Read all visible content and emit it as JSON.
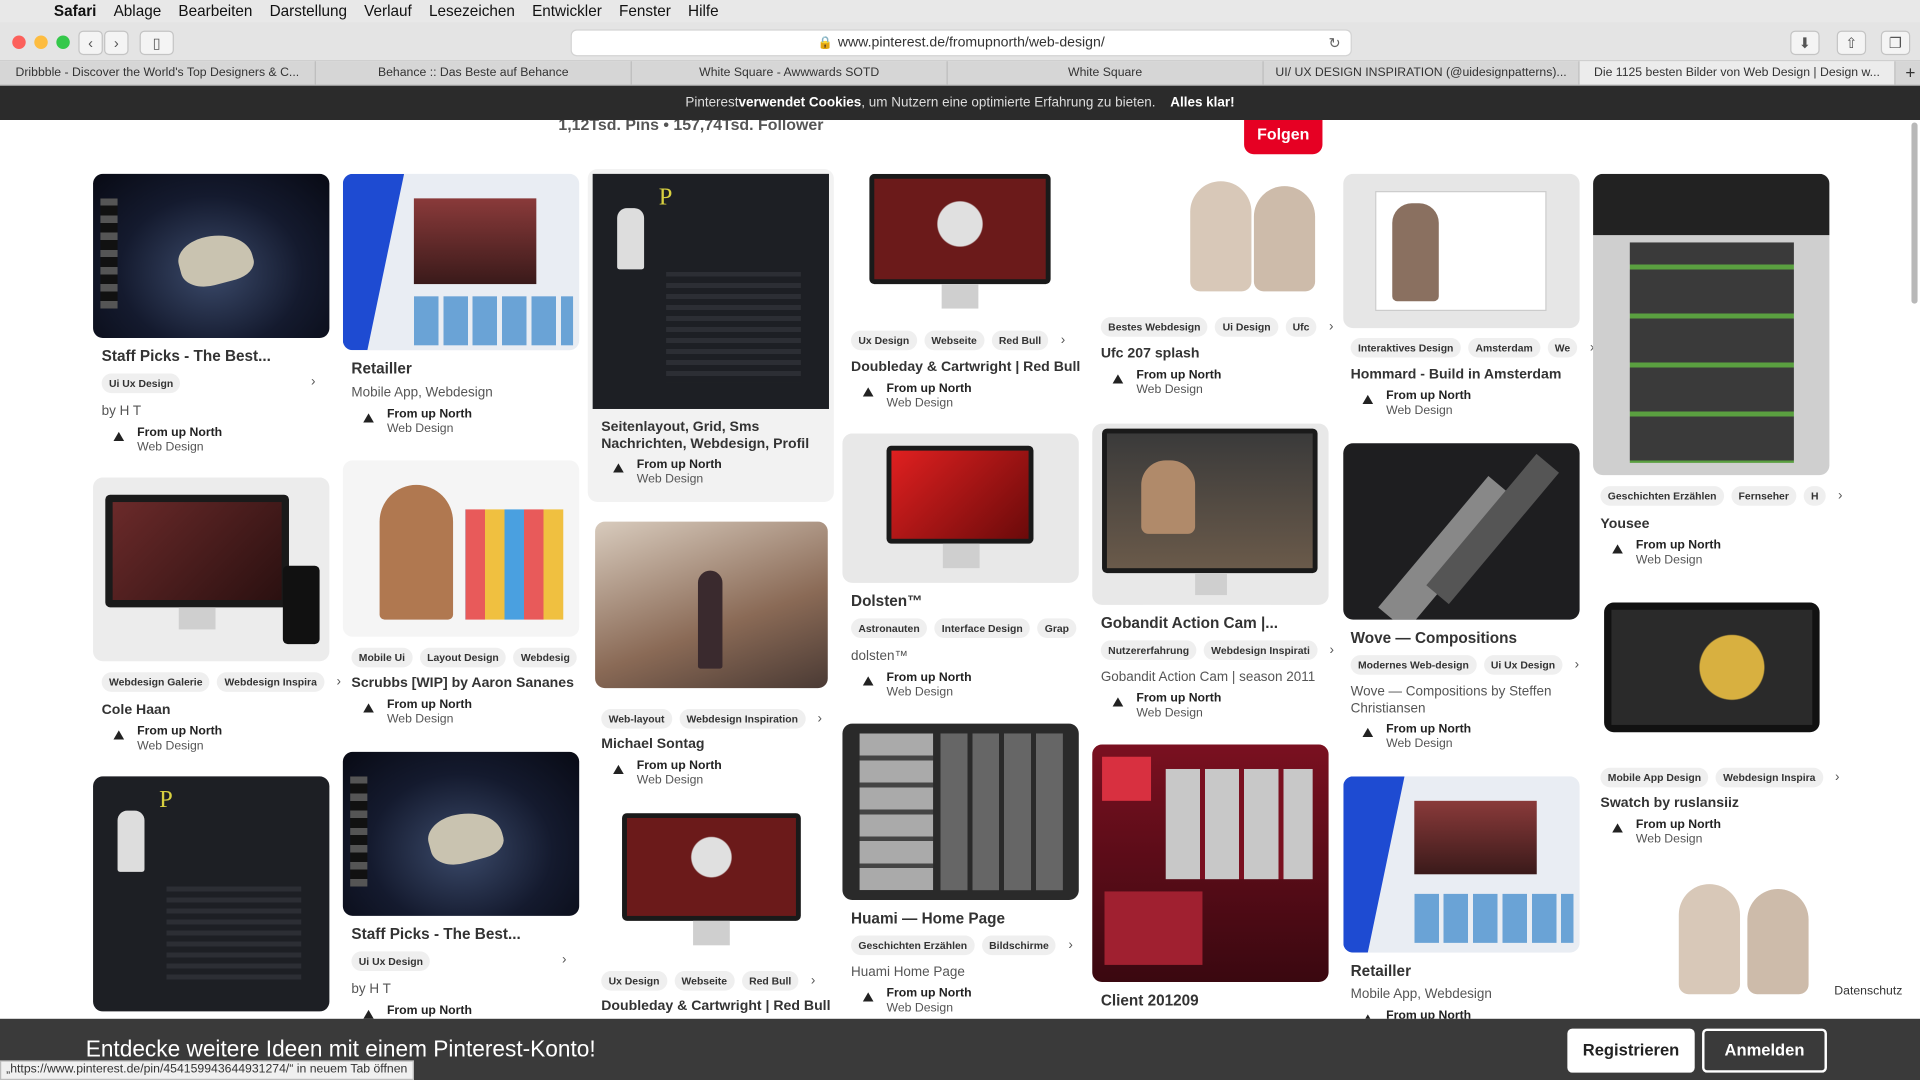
{
  "menubar": {
    "app": "Safari",
    "items": [
      "Ablage",
      "Bearbeiten",
      "Darstellung",
      "Verlauf",
      "Lesezeichen",
      "Entwickler",
      "Fenster",
      "Hilfe"
    ]
  },
  "browser": {
    "url": "www.pinterest.de/fromupnorth/web-design/",
    "tabs": [
      "Dribbble - Discover the World's Top Designers & C...",
      "Behance :: Das Beste auf Behance",
      "White Square - Awwwards SOTD",
      "White Square",
      "UI/ UX DESIGN INSPIRATION (@uidesignpatterns)...",
      "Die 1125 besten Bilder von Web Design | Design w..."
    ],
    "new_tab": "+"
  },
  "cookie": {
    "pre": "Pinterest ",
    "bold": "verwendet Cookies",
    "post": ", um Nutzern eine optimierte Erfahrung zu bieten.",
    "ok": "Alles klar!"
  },
  "board": {
    "stats": "1,12Tsd. Pins • 157,74Tsd. Follower",
    "follow": "Folgen"
  },
  "attribution": {
    "name": "From up North",
    "board": "Web Design"
  },
  "pins": {
    "c1p1": {
      "title": "Staff Picks - The Best...",
      "tags": [
        "Ui Ux Design"
      ],
      "desc": "by H T"
    },
    "c1p2": {
      "title": "Cole Haan",
      "tags": [
        "Webdesign Galerie",
        "Webdesign Inspira"
      ]
    },
    "c2p1": {
      "title": "Retailler",
      "desc": "Mobile App, Webdesign"
    },
    "c2p2": {
      "title": "Scrubbs [WIP] by Aaron Sananes",
      "tags": [
        "Mobile Ui",
        "Layout Design",
        "Webdesig"
      ]
    },
    "c2p3": {
      "title": "Staff Picks - The Best...",
      "tags": [
        "Ui Ux Design"
      ],
      "desc": "by H T"
    },
    "c3p1": {
      "title": "Seitenlayout, Grid, Sms Nachrichten, Webdesign, Profil"
    },
    "c3p2": {
      "title": "Michael Sontag",
      "tags": [
        "Web-layout",
        "Webdesign Inspiration"
      ]
    },
    "c3p3": {
      "title": "Doubleday & Cartwright | Red Bull",
      "tags": [
        "Ux Design",
        "Webseite",
        "Red Bull"
      ]
    },
    "c4p1": {
      "title": "Doubleday & Cartwright | Red Bull",
      "tags": [
        "Ux Design",
        "Webseite",
        "Red Bull"
      ]
    },
    "c4p2": {
      "title": "Dolsten™",
      "tags": [
        "Astronauten",
        "Interface Design",
        "Grap"
      ],
      "desc": "dolsten™"
    },
    "c4p3": {
      "title": "Huami — Home Page",
      "tags": [
        "Geschichten Erzählen",
        "Bildschirme"
      ],
      "desc": "Huami Home Page"
    },
    "c5p1": {
      "title": "Ufc 207 splash",
      "tags": [
        "Bestes Webdesign",
        "Ui Design",
        "Ufc"
      ]
    },
    "c5p2": {
      "title": "Gobandit Action Cam |...",
      "tags": [
        "Nutzererfahrung",
        "Webdesign Inspirati"
      ],
      "desc": "Gobandit Action Cam | season 2011"
    },
    "c5p3": {
      "title": "Client 201209"
    },
    "c6p1": {
      "title": "Hommard - Build in Amsterdam",
      "tags": [
        "Interaktives Design",
        "Amsterdam",
        "We"
      ]
    },
    "c6p2": {
      "title": "Wove — Compositions",
      "tags": [
        "Modernes Web-design",
        "Ui Ux Design"
      ],
      "desc1": "Wove — Compositions by Steffen",
      "desc2": "Christiansen"
    },
    "c6p3": {
      "title": "Retailler",
      "desc": "Mobile App, Webdesign"
    },
    "c7p1": {
      "title": "Yousee",
      "tags": [
        "Geschichten Erzählen",
        "Fernseher",
        "H"
      ]
    },
    "c7p2": {
      "title": "Swatch by ruslansiiz",
      "tags": [
        "Mobile App Design",
        "Webdesign Inspira"
      ]
    }
  },
  "signup": {
    "message": "Entdecke weitere Ideen mit einem Pinterest-Konto!",
    "register": "Registrieren",
    "login": "Anmelden"
  },
  "status": "„https://www.pinterest.de/pin/454159943644931274/“ in neuem Tab öffnen",
  "privacy": "Datenschutz"
}
